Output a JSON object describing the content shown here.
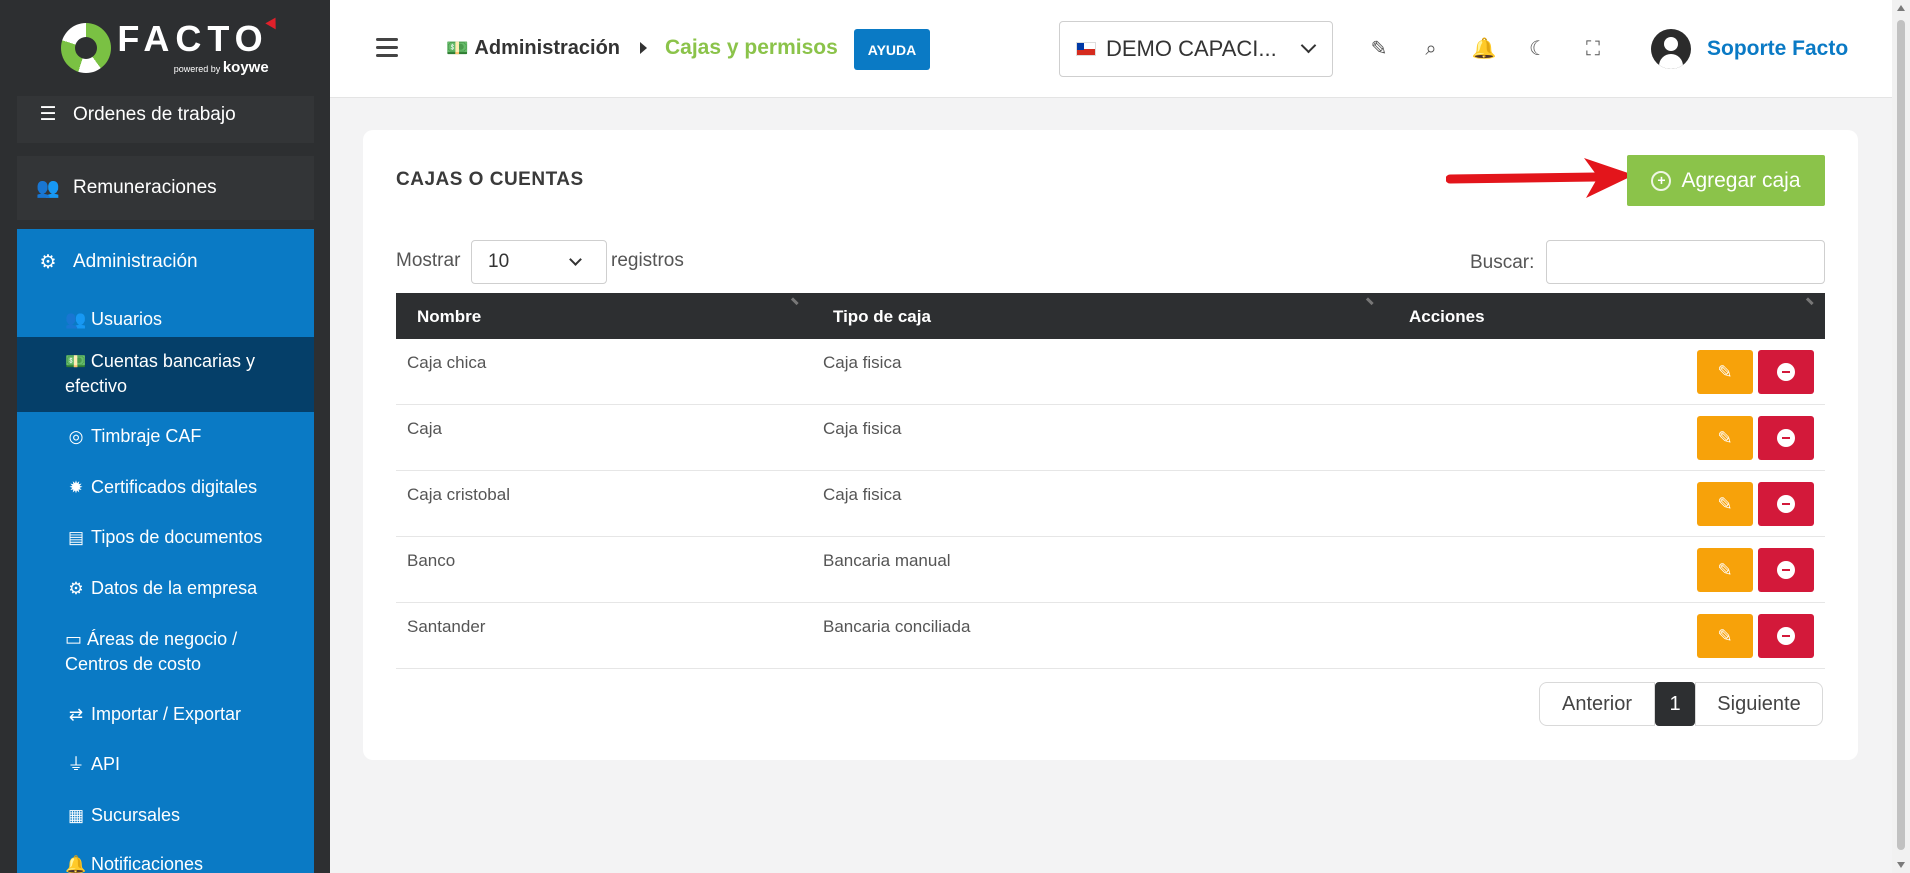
{
  "brand": {
    "name": "FACTO",
    "powered": "powered by",
    "powered_brand": "koywe"
  },
  "sidebar": {
    "items": [
      {
        "label": "Ordenes de trabajo",
        "icon": "list-check-icon"
      },
      {
        "label": "Remuneraciones",
        "icon": "users-icon"
      },
      {
        "label": "Administración",
        "icon": "gears-icon"
      }
    ],
    "subitems": [
      {
        "label": "Usuarios",
        "icon": "users-icon"
      },
      {
        "label": "Cuentas bancarias y efectivo",
        "icon": "money-bill-icon"
      },
      {
        "label": "Timbraje CAF",
        "icon": "target-icon"
      },
      {
        "label": "Certificados digitales",
        "icon": "certificate-icon"
      },
      {
        "label": "Tipos de documentos",
        "icon": "file-icon"
      },
      {
        "label": "Datos de la empresa",
        "icon": "gear-icon"
      },
      {
        "label": "Áreas de negocio / Centros de costo",
        "icon": "archive-icon"
      },
      {
        "label": "Importar / Exportar",
        "icon": "exchange-icon"
      },
      {
        "label": "API",
        "icon": "plug-icon"
      },
      {
        "label": "Sucursales",
        "icon": "building-icon"
      },
      {
        "label": "Notificaciones",
        "icon": "bell-icon"
      }
    ]
  },
  "header": {
    "breadcrumb": {
      "parent": "Administración",
      "current": "Cajas y permisos"
    },
    "help_label": "AYUDA",
    "company": "DEMO CAPACI...",
    "user_name": "Soporte Facto"
  },
  "main": {
    "title": "CAJAS O CUENTAS",
    "add_button": "Agregar caja",
    "show_label": "Mostrar",
    "show_value": "10",
    "records_label": "registros",
    "search_label": "Buscar:",
    "search_value": "",
    "columns": [
      "Nombre",
      "Tipo de caja",
      "Acciones"
    ],
    "rows": [
      {
        "nombre": "Caja chica",
        "tipo": "Caja fisica"
      },
      {
        "nombre": "Caja",
        "tipo": "Caja fisica"
      },
      {
        "nombre": "Caja cristobal",
        "tipo": "Caja fisica"
      },
      {
        "nombre": "Banco",
        "tipo": "Bancaria manual"
      },
      {
        "nombre": "Santander",
        "tipo": "Bancaria conciliada"
      }
    ],
    "pager": {
      "prev": "Anterior",
      "page": "1",
      "next": "Siguiente"
    }
  },
  "colors": {
    "accent_blue": "#0a7ac5",
    "accent_green": "#8bc34a",
    "edit_orange": "#f7a20a",
    "delete_red": "#d3193a",
    "dark": "#2d2f31",
    "annotation_arrow": "#e3151b"
  }
}
